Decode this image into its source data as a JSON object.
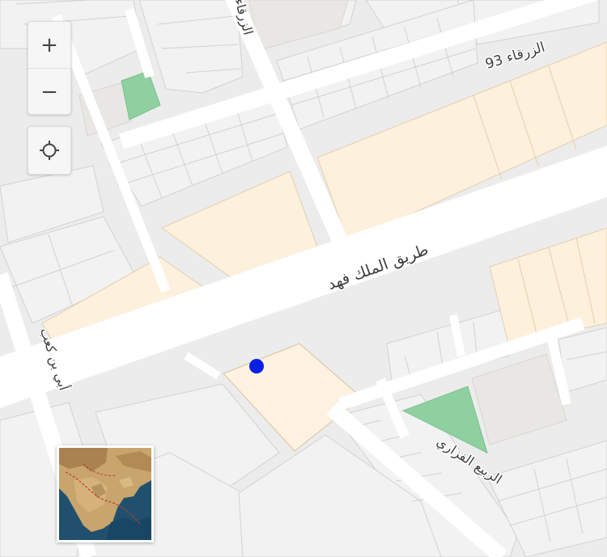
{
  "map": {
    "streets": {
      "zarqa": "الزرقاء",
      "zarqa_93": "الزرقاء 93",
      "king_fahd_road": "طريق الملك فهد",
      "abi_bin_kaab": "أبي بن كعب",
      "rabee_alfazari": "الربيع الفزاري"
    },
    "colors": {
      "background": "#ececec",
      "road": "#ffffff",
      "parcel_outline": "#d2d2d2",
      "parcel_beige": "#fdf0dd",
      "parcel_grey": "#e9e7e3",
      "park_green": "#8fd0a0",
      "marker_blue": "#0a1fe6",
      "label_text": "#3d3d3d"
    },
    "marker": {
      "type": "location-dot"
    }
  },
  "controls": {
    "zoom_in_label": "+",
    "zoom_out_label": "−",
    "locate_icon": "crosshair-icon"
  },
  "minimap": {
    "icon": "arabian-peninsula-satellite-thumbnail"
  }
}
